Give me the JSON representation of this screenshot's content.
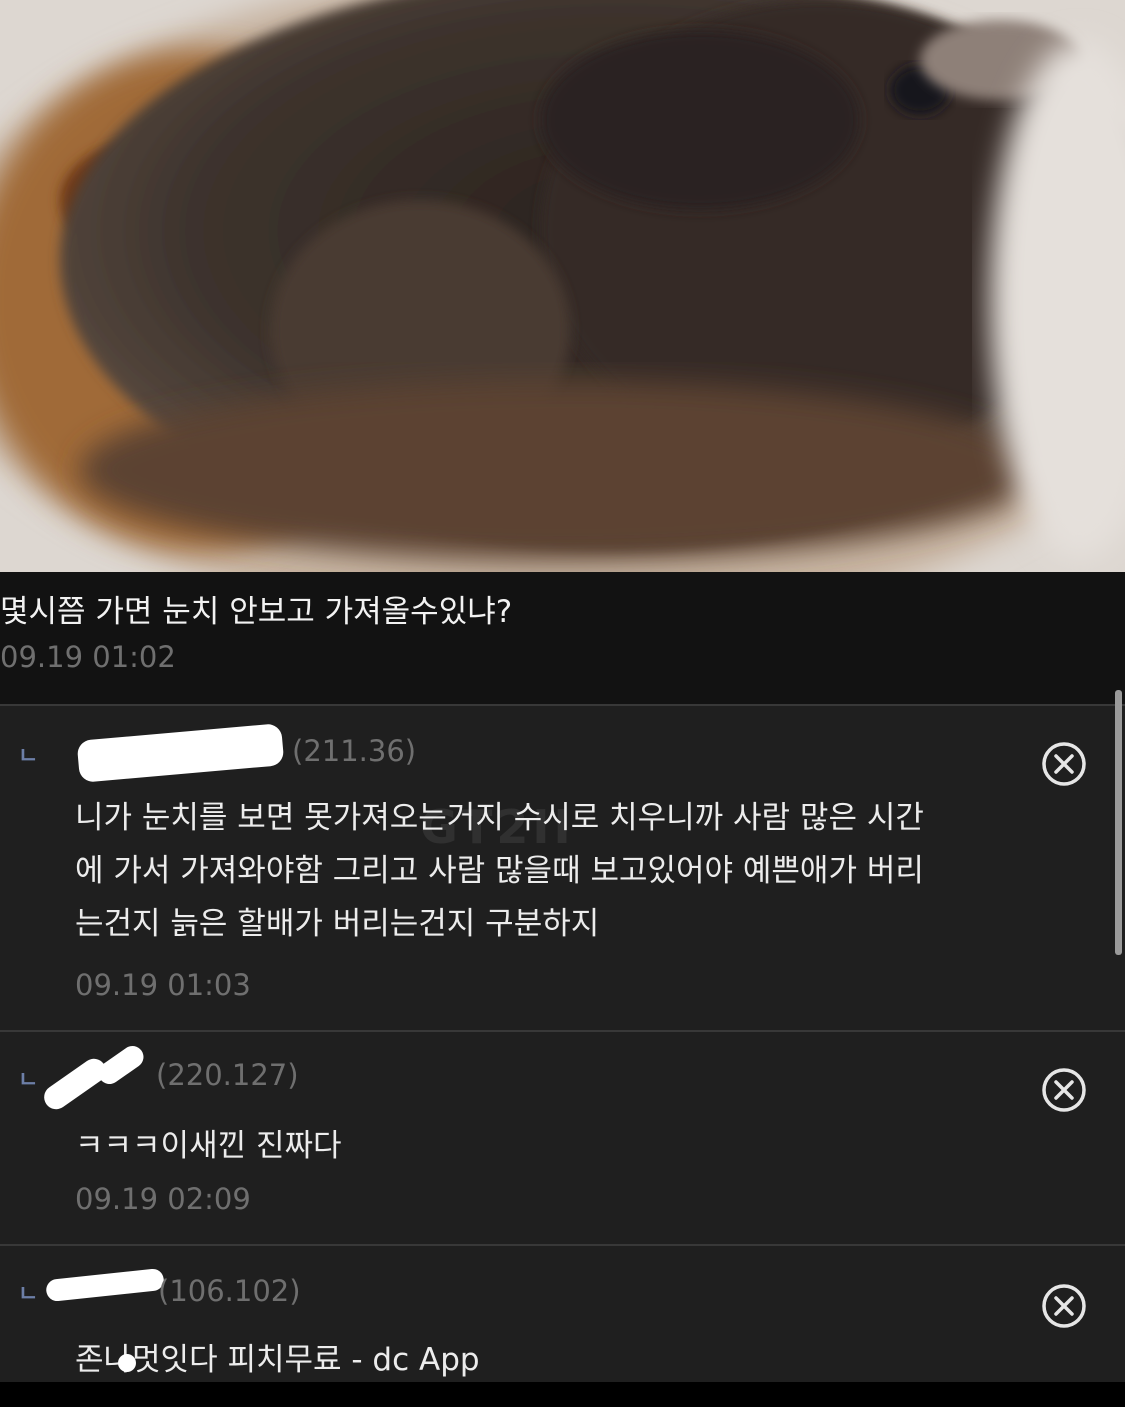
{
  "post": {
    "text": "몇시쯤 가면 눈치 안보고 가져올수있냐?",
    "time": "09.19 01:02"
  },
  "watermark": "GT2II",
  "comments": [
    {
      "reply_mark": "ㄴ",
      "ip": "(211.36)",
      "text": "니가 눈치를 보면 못가져오는거지 수시로 치우니까 사람 많은 시간\n에 가서 가져와야함 그리고 사람 많을때 보고있어야 예쁜애가 버리\n는건지 늙은 할배가 버리는건지 구분하지",
      "time": "09.19 01:03"
    },
    {
      "reply_mark": "ㄴ",
      "ip": "(220.127)",
      "text": "ㅋㅋㅋ이새낀 진짜다",
      "time": "09.19 02:09"
    },
    {
      "reply_mark": "ㄴ",
      "ip": "(106.102)",
      "text": "존나멋잇다 피치무료 - dc App",
      "time": ""
    }
  ],
  "icons": {
    "delete": "close-circle-icon",
    "reply": "reply-arrow-icon"
  },
  "colors": {
    "background": "#1e1e1e",
    "text": "#ececec",
    "muted": "#6f6f6f",
    "reply_mark": "#6d7fa8"
  }
}
